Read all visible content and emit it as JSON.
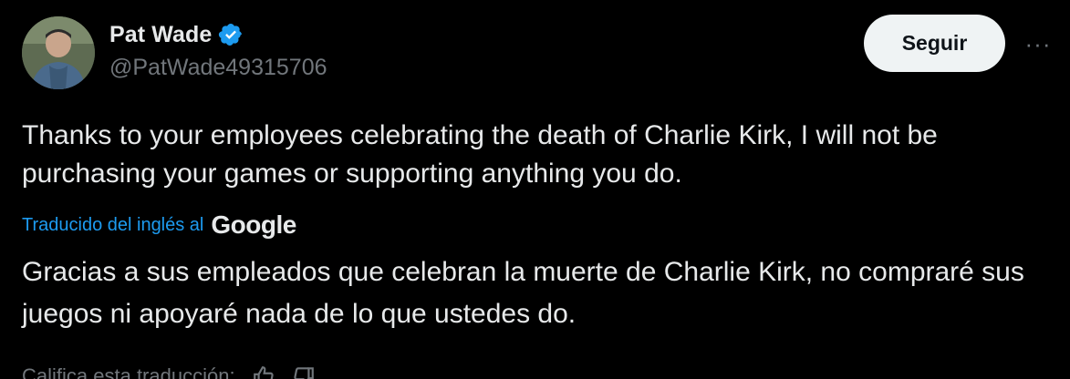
{
  "author": {
    "display_name": "Pat Wade",
    "handle": "@PatWade49315706",
    "avatar_icon": "user-photo",
    "verified_icon": "verified-badge-icon",
    "verified_color": "#1d9bf0"
  },
  "actions": {
    "follow_label": "Seguir",
    "more_label": "···"
  },
  "post": {
    "text": "Thanks to your employees celebrating the death of Charlie Kirk, I will not be purchasing your games or supporting anything you do."
  },
  "translation": {
    "label": "Traducido del inglés al",
    "provider": "Google",
    "text": "Gracias a sus empleados que celebran la muerte de Charlie Kirk, no compraré sus juegos ni apoyaré nada de lo que ustedes do.",
    "rate_label": "Califica esta traducción:"
  },
  "colors": {
    "background": "#000000",
    "text_primary": "#e7e9ea",
    "text_secondary": "#71767b",
    "link": "#1d9bf0",
    "button_bg": "#eff3f4",
    "button_text": "#0f1419"
  }
}
